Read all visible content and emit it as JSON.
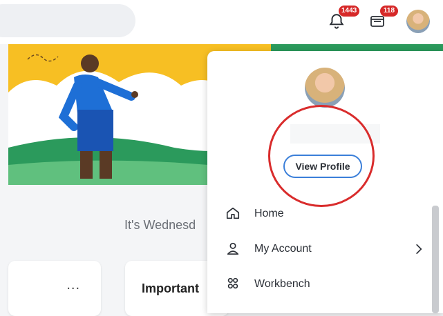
{
  "header": {
    "notifications_count": "1443",
    "inbox_count": "118"
  },
  "main": {
    "greeting": "It's Wednesd",
    "card_more": "...",
    "card_title": "Important"
  },
  "profile_menu": {
    "view_profile_label": "View Profile",
    "items": [
      {
        "label": "Home",
        "icon": "home-icon"
      },
      {
        "label": "My Account",
        "icon": "person-icon"
      },
      {
        "label": "Workbench",
        "icon": "people-icon"
      }
    ]
  },
  "colors": {
    "badge": "#d62828",
    "accent": "#3b7fd9",
    "highlight_circle": "#d92c2c"
  }
}
